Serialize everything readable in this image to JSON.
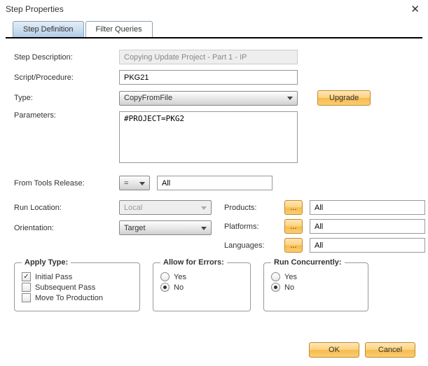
{
  "window": {
    "title": "Step Properties"
  },
  "tabs": {
    "active": "Step Definition",
    "other": "Filter Queries"
  },
  "labels": {
    "stepDescription": "Step Description:",
    "scriptProcedure": "Script/Procedure:",
    "type": "Type:",
    "parameters": "Parameters:",
    "fromToolsRelease": "From Tools Release:",
    "runLocation": "Run Location:",
    "orientation": "Orientation:",
    "products": "Products:",
    "platforms": "Platforms:",
    "languages": "Languages:"
  },
  "values": {
    "stepDescription": "Copying Update Project - Part 1 - IP",
    "scriptProcedure": "PKG21",
    "type": "CopyFromFile",
    "parameters": "#PROJECT=PKG2",
    "fromToolsReleaseOp": "=",
    "fromToolsReleaseVal": "All",
    "runLocation": "Local",
    "orientation": "Target",
    "products": "All",
    "platforms": "All",
    "languages": "All"
  },
  "buttons": {
    "upgrade": "Upgrade",
    "ellipsis": "...",
    "ok": "OK",
    "cancel": "Cancel"
  },
  "applyType": {
    "legend": "Apply Type:",
    "initialPass": "Initial Pass",
    "subsequentPass": "Subsequent Pass",
    "moveToProduction": "Move To Production"
  },
  "allowForErrors": {
    "legend": "Allow for Errors:",
    "yes": "Yes",
    "no": "No",
    "selected": "No"
  },
  "runConcurrently": {
    "legend": "Run Concurrently:",
    "yes": "Yes",
    "no": "No",
    "selected": "No"
  }
}
